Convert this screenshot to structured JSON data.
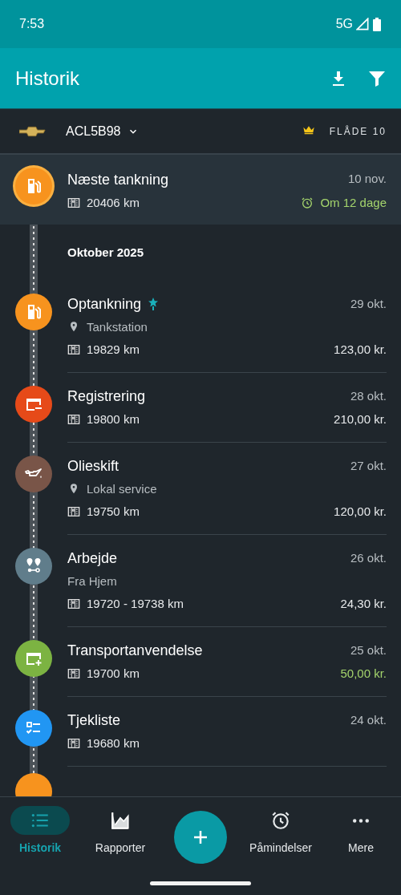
{
  "status_bar": {
    "time": "7:53",
    "network": "5G"
  },
  "app_bar": {
    "title": "Historik"
  },
  "vehicle": {
    "plate": "ACL5B98",
    "plan": "FLÅDE 10"
  },
  "upcoming": {
    "kind": "fuel",
    "color": "#f7931e",
    "title": "Næste tankning",
    "date": "10 nov.",
    "odometer": "20406 km",
    "due": "Om 12 dage"
  },
  "month": "Oktober 2025",
  "entries": [
    {
      "kind": "fuel",
      "color": "#f7931e",
      "title": "Optankning",
      "starred": true,
      "date": "29 okt.",
      "location": "Tankstation",
      "odometer": "19829 km",
      "amount": "123,00 kr.",
      "income": false
    },
    {
      "kind": "registration",
      "color": "#e64a19",
      "title": "Registrering",
      "starred": false,
      "date": "28 okt.",
      "odometer": "19800 km",
      "amount": "210,00 kr.",
      "income": false
    },
    {
      "kind": "oil",
      "color": "#795548",
      "title": "Olieskift",
      "starred": false,
      "date": "27 okt.",
      "location": "Lokal service",
      "odometer": "19750 km",
      "amount": "120,00 kr.",
      "income": false
    },
    {
      "kind": "trip",
      "color": "#607d8b",
      "title": "Arbejde",
      "starred": false,
      "date": "26 okt.",
      "note": "Fra Hjem",
      "odometer": "19720 - 19738 km",
      "amount": "24,30 kr.",
      "income": false
    },
    {
      "kind": "income",
      "color": "#7cb342",
      "title": "Transportanvendelse",
      "starred": false,
      "date": "25 okt.",
      "odometer": "19700 km",
      "amount": "50,00 kr.",
      "income": true
    },
    {
      "kind": "checklist",
      "color": "#2196f3",
      "title": "Tjekliste",
      "starred": false,
      "date": "24 okt.",
      "odometer": "19680 km"
    }
  ],
  "nav": [
    {
      "kind": "list",
      "label": "Historik",
      "selected": true
    },
    {
      "kind": "chart",
      "label": "Rapporter",
      "selected": false
    },
    {
      "kind": "add"
    },
    {
      "kind": "alarm",
      "label": "Påmindelser",
      "selected": false
    },
    {
      "kind": "more",
      "label": "Mere",
      "selected": false
    }
  ]
}
